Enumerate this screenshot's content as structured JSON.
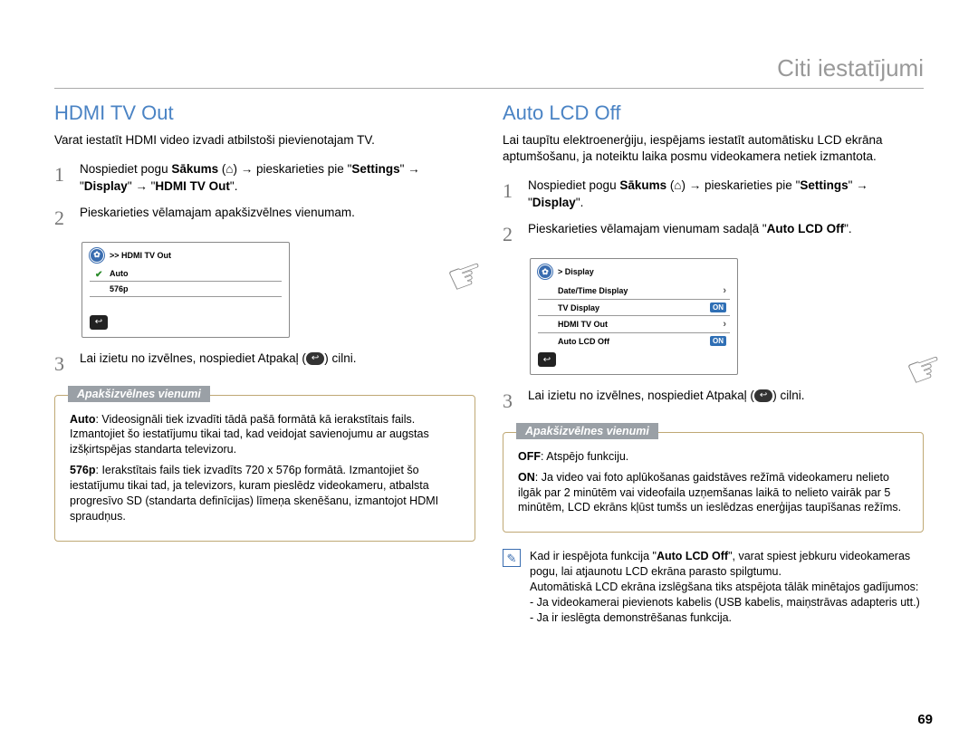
{
  "header": {
    "title": "Citi iestatījumi"
  },
  "page_number": "69",
  "left": {
    "title": "HDMI TV Out",
    "intro": "Varat iestatīt HDMI video izvadi atbilstoši pievienotajam TV.",
    "step1_a": "Nospiediet pogu ",
    "step1_b": "Sākums",
    "step1_c": " → pieskarieties pie \"",
    "step1_d": "Settings",
    "step1_e": "\" → \"",
    "step1_f": "Display",
    "step1_g": "\" → \"",
    "step1_h": "HDMI TV Out",
    "step1_i": "\".",
    "step2": "Pieskarieties vēlamajam apakšizvēlnes vienumam.",
    "step3_a": "Lai izietu no izvēlnes, nospiediet Atpakaļ (",
    "step3_b": ") cilni.",
    "miniui": {
      "title": ">> HDMI TV Out",
      "row1": "Auto",
      "row2": "576p"
    },
    "sub": {
      "tab": "Apakšizvēlnes vienumi",
      "auto_lbl": "Auto",
      "auto_txt": ": Videosignāli tiek izvadīti tādā pašā formātā kā ierakstītais fails. Izmantojiet šo iestatījumu tikai tad, kad veidojat savienojumu ar augstas izšķirtspējas standarta televizoru.",
      "p576_lbl": "576p",
      "p576_txt": ": Ierakstītais fails tiek izvadīts 720 x 576p formātā. Izmantojiet šo iestatījumu tikai tad, ja televizors, kuram pieslēdz videokameru, atbalsta progresīvo SD (standarta definīcijas) līmeņa skenēšanu, izmantojot HDMI spraudņus."
    }
  },
  "right": {
    "title": "Auto LCD Off",
    "intro": "Lai taupītu elektroenerģiju, iespējams iestatīt automātisku LCD ekrāna aptumšošanu, ja noteiktu laika posmu videokamera netiek izmantota.",
    "step1_a": "Nospiediet pogu ",
    "step1_b": "Sākums",
    "step1_c": " → pieskarieties pie \"",
    "step1_d": "Settings",
    "step1_e": "\" → \"",
    "step1_f": "Display",
    "step1_g": "\".",
    "step2_a": "Pieskarieties vēlamajam vienumam sadaļā \"",
    "step2_b": "Auto LCD Off",
    "step2_c": "\".",
    "step3_a": "Lai izietu no izvēlnes, nospiediet Atpakaļ (",
    "step3_b": ") cilni.",
    "miniui": {
      "title": "> Display",
      "row1": "Date/Time Display",
      "row2": "TV Display",
      "row2_badge": "ON",
      "row3": "HDMI TV Out",
      "row4": "Auto LCD Off",
      "row4_badge": "ON"
    },
    "sub": {
      "tab": "Apakšizvēlnes vienumi",
      "off_lbl": "OFF",
      "off_txt": ": Atspējo funkciju.",
      "on_lbl": "ON",
      "on_txt": ": Ja video vai foto aplūkošanas gaidstāves režīmā videokameru nelieto ilgāk par 2 minūtēm vai videofaila uzņemšanas laikā to nelieto vairāk par 5 minūtēm, LCD ekrāns kļūst tumšs un ieslēdzas enerģijas taupīšanas režīms."
    },
    "note": {
      "line1a": "Kad ir iespējota funkcija \"",
      "line1b": "Auto LCD Off",
      "line1c": "\", varat spiest jebkuru videokameras pogu, lai atjaunotu LCD ekrāna parasto spilgtumu.",
      "line2": "Automātiskā LCD ekrāna izslēgšana tiks atspējota tālāk minētajos gadījumos:",
      "b1": "- Ja videokamerai pievienots kabelis (USB kabelis, maiņstrāvas adapteris utt.)",
      "b2": "- Ja ir ieslēgta demonstrēšanas funkcija."
    }
  }
}
